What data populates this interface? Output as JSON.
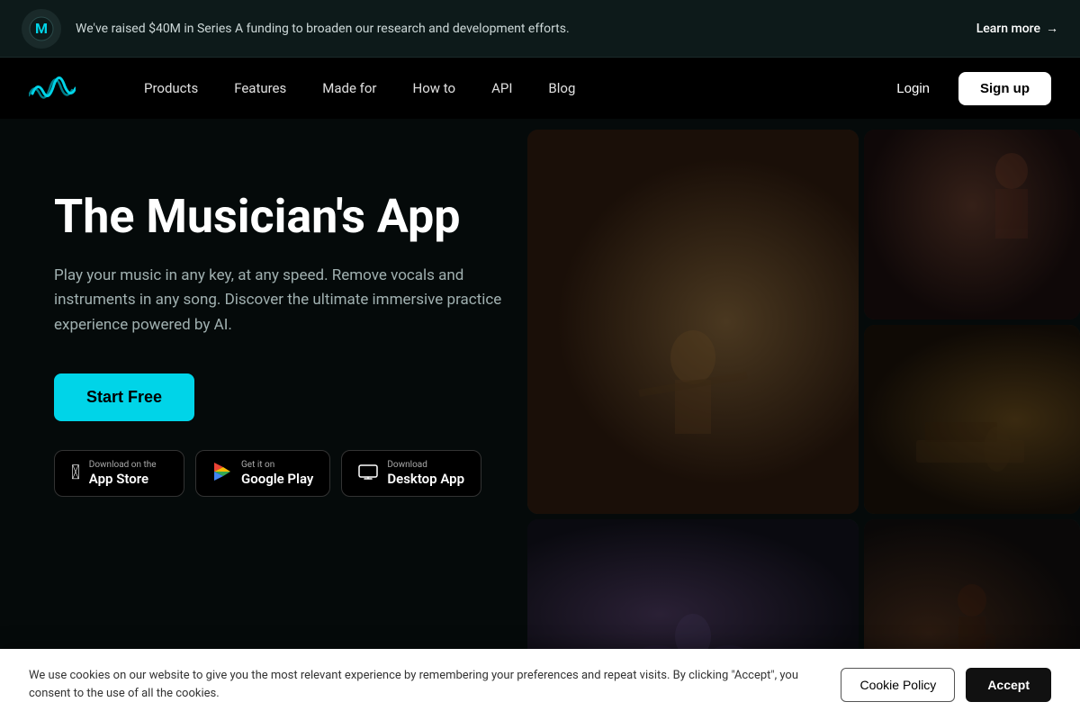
{
  "announcement": {
    "text": "We've raised $40M in Series A funding to broaden our research and development efforts.",
    "learn_more_label": "Learn more"
  },
  "nav": {
    "products_label": "Products",
    "features_label": "Features",
    "made_for_label": "Made for",
    "how_to_label": "How to",
    "api_label": "API",
    "blog_label": "Blog",
    "login_label": "Login",
    "signup_label": "Sign up"
  },
  "hero": {
    "title": "The Musician's App",
    "subtitle": "Play your music in any key, at any speed. Remove vocals and instruments in any song. Discover the ultimate immersive practice experience powered by AI.",
    "start_free_label": "Start Free",
    "download_app_store_label": "Download on the",
    "download_app_store_name": "App Store",
    "download_google_label": "Get it on",
    "download_google_name": "Google Play",
    "download_desktop_label": "Download",
    "download_desktop_name": "Desktop App"
  },
  "cookie": {
    "text": "We use cookies on our website to give you the most relevant experience by remembering your preferences and repeat visits. By clicking \"Accept\", you consent to the use of all the cookies.",
    "policy_label": "Cookie Policy",
    "accept_label": "Accept"
  }
}
